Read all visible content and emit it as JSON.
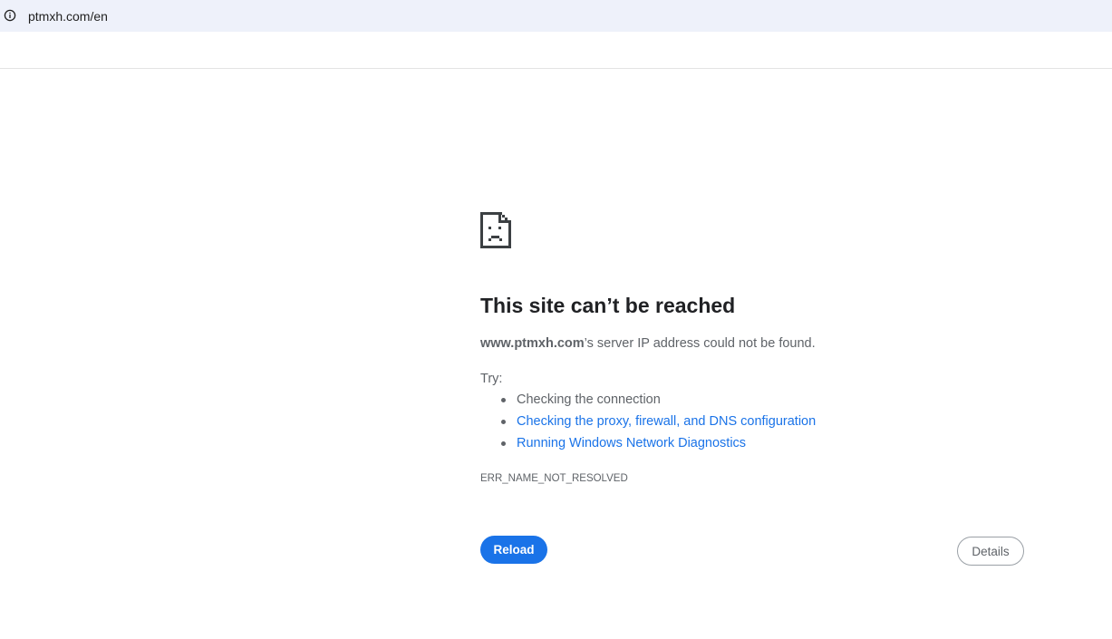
{
  "browser": {
    "url": "ptmxh.com/en",
    "site_info_icon": "info-icon"
  },
  "error_page": {
    "icon": "sad-page-icon",
    "title": "This site can’t be reached",
    "host": "www.ptmxh.com",
    "message_suffix": "’s server IP address could not be found.",
    "try_label": "Try:",
    "suggestions": [
      {
        "text": "Checking the connection",
        "is_link": false
      },
      {
        "text": "Checking the proxy, firewall, and DNS configuration",
        "is_link": true
      },
      {
        "text": "Running Windows Network Diagnostics",
        "is_link": true
      }
    ],
    "error_code": "ERR_NAME_NOT_RESOLVED",
    "reload_label": "Reload",
    "details_label": "Details"
  },
  "colors": {
    "accent": "#1a73e8",
    "address_bar_bg": "#eef1fa",
    "text_secondary": "#5f6368"
  }
}
